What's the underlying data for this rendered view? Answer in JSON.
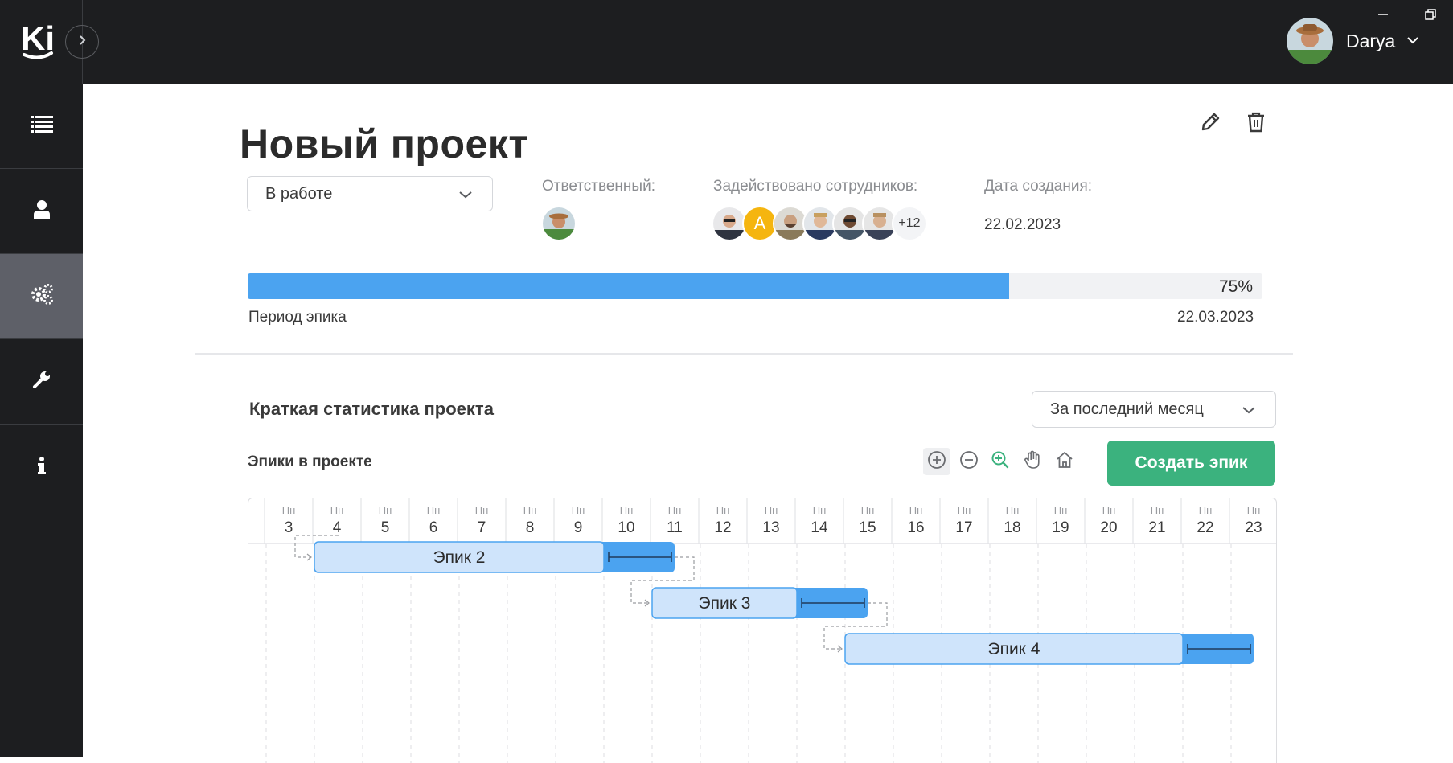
{
  "app": {
    "logo_text": "Ki"
  },
  "user": {
    "name": "Darya"
  },
  "sidebar": {
    "items": [
      {
        "icon": "list-icon"
      },
      {
        "icon": "user-icon"
      },
      {
        "icon": "gears-icon",
        "active": true
      },
      {
        "icon": "wrench-icon"
      },
      {
        "icon": "info-icon"
      }
    ]
  },
  "project": {
    "title": "Новый проект",
    "status": "В работе",
    "responsible_label": "Ответственный:",
    "members_label": "Задействовано сотрудников:",
    "members_extra": "+12",
    "member_initial": "A",
    "created_label": "Дата создания:",
    "created_date": "22.02.2023",
    "progress": 75,
    "progress_text": "75%",
    "period_label": "Период эпика",
    "end_date": "22.03.2023"
  },
  "stats": {
    "title": "Краткая статистика проекта",
    "period_select": "За последний месяц",
    "epics_title": "Эпики в проекте",
    "create_button": "Создать эпик"
  },
  "gantt": {
    "days": [
      {
        "wd": "Пн",
        "d": "3"
      },
      {
        "wd": "Пн",
        "d": "4"
      },
      {
        "wd": "Пн",
        "d": "5"
      },
      {
        "wd": "Пн",
        "d": "6"
      },
      {
        "wd": "Пн",
        "d": "7"
      },
      {
        "wd": "Пн",
        "d": "8"
      },
      {
        "wd": "Пн",
        "d": "9"
      },
      {
        "wd": "Пн",
        "d": "10"
      },
      {
        "wd": "Пн",
        "d": "11"
      },
      {
        "wd": "Пн",
        "d": "12"
      },
      {
        "wd": "Пн",
        "d": "13"
      },
      {
        "wd": "Пн",
        "d": "14"
      },
      {
        "wd": "Пн",
        "d": "15"
      },
      {
        "wd": "Пн",
        "d": "16"
      },
      {
        "wd": "Пн",
        "d": "17"
      },
      {
        "wd": "Пн",
        "d": "18"
      },
      {
        "wd": "Пн",
        "d": "19"
      },
      {
        "wd": "Пн",
        "d": "20"
      },
      {
        "wd": "Пн",
        "d": "21"
      },
      {
        "wd": "Пн",
        "d": "22"
      },
      {
        "wd": "Пн",
        "d": "23"
      }
    ],
    "epics": [
      {
        "label": "Эпик 2",
        "start_day": "4",
        "end_day": "11",
        "done_day": "10"
      },
      {
        "label": "Эпик 3",
        "start_day": "11",
        "end_day": "15",
        "done_day": "14"
      },
      {
        "label": "Эпик 4",
        "start_day": "15",
        "end_day": "23",
        "done_day": "22"
      }
    ]
  },
  "colors": {
    "accent": "#4ba3f0",
    "bar_fill": "#cfe4fb",
    "create_button": "#3bb27e",
    "dark": "#1d1e20"
  }
}
